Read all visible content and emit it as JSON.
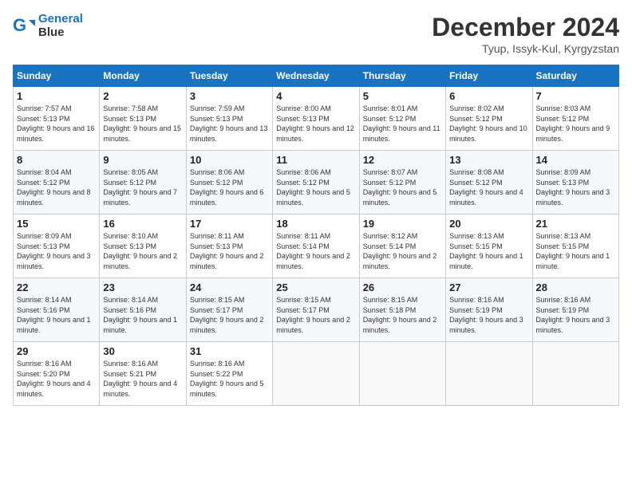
{
  "header": {
    "logo_line1": "General",
    "logo_line2": "Blue",
    "month": "December 2024",
    "location": "Tyup, Issyk-Kul, Kyrgyzstan"
  },
  "days_of_week": [
    "Sunday",
    "Monday",
    "Tuesday",
    "Wednesday",
    "Thursday",
    "Friday",
    "Saturday"
  ],
  "weeks": [
    [
      {
        "day": "1",
        "sunrise": "7:57 AM",
        "sunset": "5:13 PM",
        "daylight": "9 hours and 16 minutes."
      },
      {
        "day": "2",
        "sunrise": "7:58 AM",
        "sunset": "5:13 PM",
        "daylight": "9 hours and 15 minutes."
      },
      {
        "day": "3",
        "sunrise": "7:59 AM",
        "sunset": "5:13 PM",
        "daylight": "9 hours and 13 minutes."
      },
      {
        "day": "4",
        "sunrise": "8:00 AM",
        "sunset": "5:13 PM",
        "daylight": "9 hours and 12 minutes."
      },
      {
        "day": "5",
        "sunrise": "8:01 AM",
        "sunset": "5:12 PM",
        "daylight": "9 hours and 11 minutes."
      },
      {
        "day": "6",
        "sunrise": "8:02 AM",
        "sunset": "5:12 PM",
        "daylight": "9 hours and 10 minutes."
      },
      {
        "day": "7",
        "sunrise": "8:03 AM",
        "sunset": "5:12 PM",
        "daylight": "9 hours and 9 minutes."
      }
    ],
    [
      {
        "day": "8",
        "sunrise": "8:04 AM",
        "sunset": "5:12 PM",
        "daylight": "9 hours and 8 minutes."
      },
      {
        "day": "9",
        "sunrise": "8:05 AM",
        "sunset": "5:12 PM",
        "daylight": "9 hours and 7 minutes."
      },
      {
        "day": "10",
        "sunrise": "8:06 AM",
        "sunset": "5:12 PM",
        "daylight": "9 hours and 6 minutes."
      },
      {
        "day": "11",
        "sunrise": "8:06 AM",
        "sunset": "5:12 PM",
        "daylight": "9 hours and 5 minutes."
      },
      {
        "day": "12",
        "sunrise": "8:07 AM",
        "sunset": "5:12 PM",
        "daylight": "9 hours and 5 minutes."
      },
      {
        "day": "13",
        "sunrise": "8:08 AM",
        "sunset": "5:12 PM",
        "daylight": "9 hours and 4 minutes."
      },
      {
        "day": "14",
        "sunrise": "8:09 AM",
        "sunset": "5:13 PM",
        "daylight": "9 hours and 3 minutes."
      }
    ],
    [
      {
        "day": "15",
        "sunrise": "8:09 AM",
        "sunset": "5:13 PM",
        "daylight": "9 hours and 3 minutes."
      },
      {
        "day": "16",
        "sunrise": "8:10 AM",
        "sunset": "5:13 PM",
        "daylight": "9 hours and 2 minutes."
      },
      {
        "day": "17",
        "sunrise": "8:11 AM",
        "sunset": "5:13 PM",
        "daylight": "9 hours and 2 minutes."
      },
      {
        "day": "18",
        "sunrise": "8:11 AM",
        "sunset": "5:14 PM",
        "daylight": "9 hours and 2 minutes."
      },
      {
        "day": "19",
        "sunrise": "8:12 AM",
        "sunset": "5:14 PM",
        "daylight": "9 hours and 2 minutes."
      },
      {
        "day": "20",
        "sunrise": "8:13 AM",
        "sunset": "5:15 PM",
        "daylight": "9 hours and 1 minute."
      },
      {
        "day": "21",
        "sunrise": "8:13 AM",
        "sunset": "5:15 PM",
        "daylight": "9 hours and 1 minute."
      }
    ],
    [
      {
        "day": "22",
        "sunrise": "8:14 AM",
        "sunset": "5:16 PM",
        "daylight": "9 hours and 1 minute."
      },
      {
        "day": "23",
        "sunrise": "8:14 AM",
        "sunset": "5:16 PM",
        "daylight": "9 hours and 1 minute."
      },
      {
        "day": "24",
        "sunrise": "8:15 AM",
        "sunset": "5:17 PM",
        "daylight": "9 hours and 2 minutes."
      },
      {
        "day": "25",
        "sunrise": "8:15 AM",
        "sunset": "5:17 PM",
        "daylight": "9 hours and 2 minutes."
      },
      {
        "day": "26",
        "sunrise": "8:15 AM",
        "sunset": "5:18 PM",
        "daylight": "9 hours and 2 minutes."
      },
      {
        "day": "27",
        "sunrise": "8:16 AM",
        "sunset": "5:19 PM",
        "daylight": "9 hours and 3 minutes."
      },
      {
        "day": "28",
        "sunrise": "8:16 AM",
        "sunset": "5:19 PM",
        "daylight": "9 hours and 3 minutes."
      }
    ],
    [
      {
        "day": "29",
        "sunrise": "8:16 AM",
        "sunset": "5:20 PM",
        "daylight": "9 hours and 4 minutes."
      },
      {
        "day": "30",
        "sunrise": "8:16 AM",
        "sunset": "5:21 PM",
        "daylight": "9 hours and 4 minutes."
      },
      {
        "day": "31",
        "sunrise": "8:16 AM",
        "sunset": "5:22 PM",
        "daylight": "9 hours and 5 minutes."
      },
      null,
      null,
      null,
      null
    ]
  ]
}
